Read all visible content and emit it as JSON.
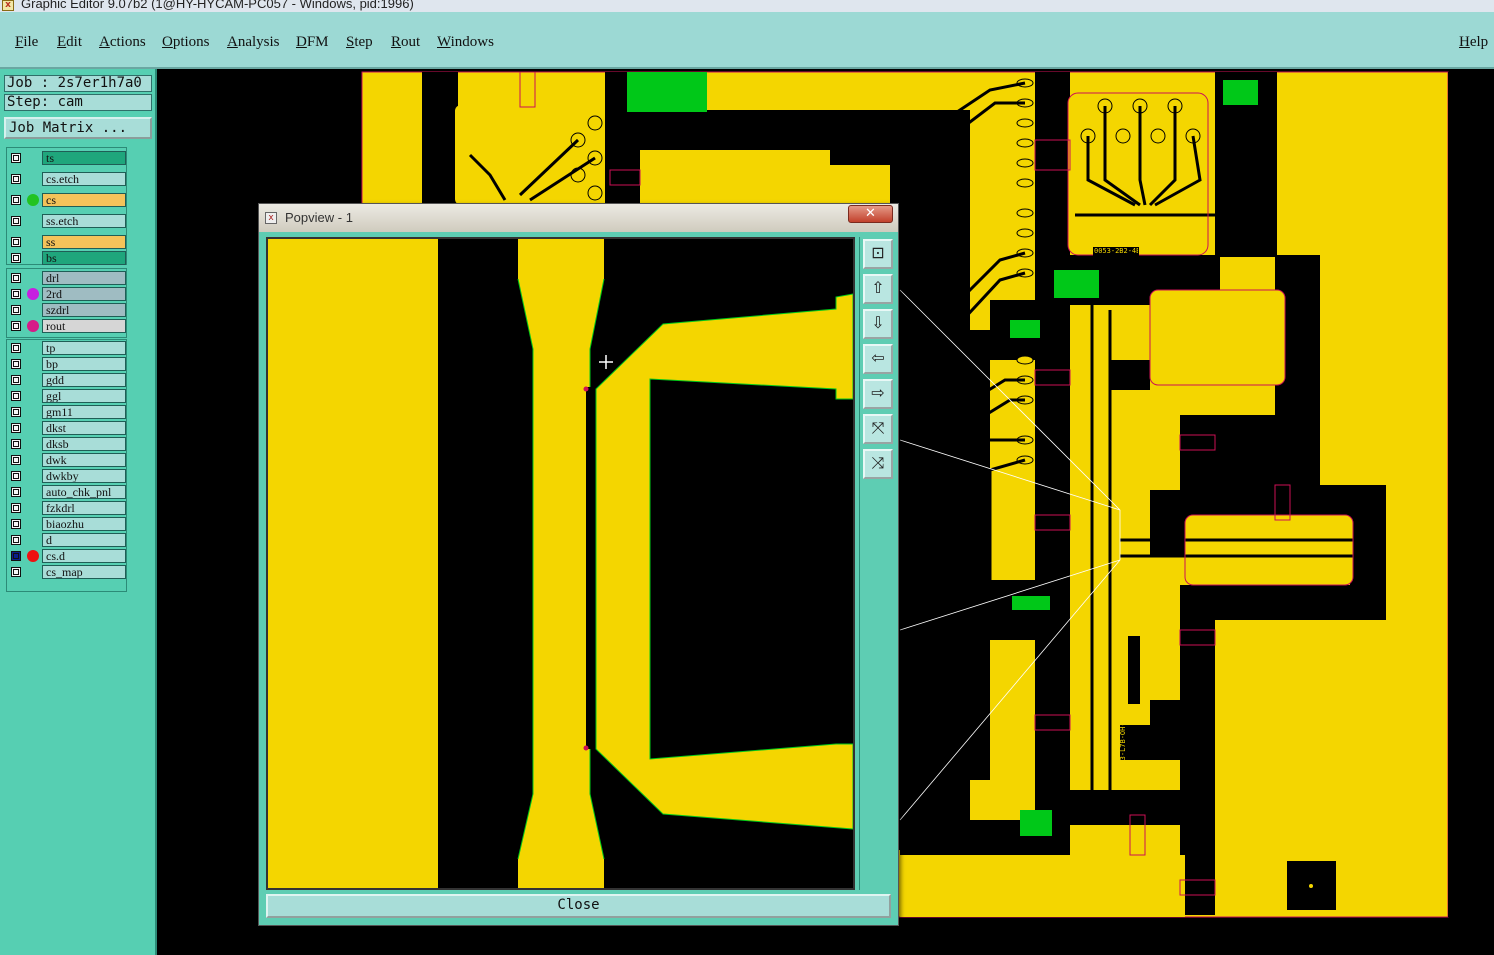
{
  "window": {
    "title": "Graphic Editor 9.07b2 (1@HY-HYCAM-PC057 - Windows, pid:1996)"
  },
  "menu": {
    "items": [
      "File",
      "Edit",
      "Actions",
      "Options",
      "Analysis",
      "DFM",
      "Step",
      "Rout",
      "Windows"
    ],
    "help": "Help"
  },
  "job": {
    "job_label": "Job : 2s7er1h7a0",
    "step_label": "Step: cam",
    "matrix_button": "Job Matrix ..."
  },
  "layers": {
    "group1": [
      {
        "name": "ts",
        "color": "#1fa67c",
        "dot": ""
      },
      {
        "name": "cs.etch",
        "color": "#a8ddd8",
        "dot": ""
      },
      {
        "name": "cs",
        "color": "#f4c35a",
        "dot": "#22c322"
      },
      {
        "name": "ss.etch",
        "color": "#a8ddd8",
        "dot": ""
      },
      {
        "name": "ss",
        "color": "#f4c35a",
        "dot": ""
      },
      {
        "name": "bs",
        "color": "#1fa67c",
        "dot": ""
      }
    ],
    "group2": [
      {
        "name": "drl",
        "color": "#9fbcc2",
        "dot": ""
      },
      {
        "name": "2rd",
        "color": "#9fbcc2",
        "dot": "#c61fe0"
      },
      {
        "name": "szdrl",
        "color": "#9fbcc2",
        "dot": ""
      },
      {
        "name": "rout",
        "color": "#d6d6d6",
        "dot": "#d61a88"
      }
    ],
    "group3": [
      {
        "name": "tp",
        "color": "#a8ddd8",
        "dot": ""
      },
      {
        "name": "bp",
        "color": "#a8ddd8",
        "dot": ""
      },
      {
        "name": "gdd",
        "color": "#a8ddd8",
        "dot": ""
      },
      {
        "name": "ggl",
        "color": "#a8ddd8",
        "dot": ""
      },
      {
        "name": "gm11",
        "color": "#a8ddd8",
        "dot": ""
      },
      {
        "name": "dkst",
        "color": "#a8ddd8",
        "dot": ""
      },
      {
        "name": "dksb",
        "color": "#a8ddd8",
        "dot": ""
      },
      {
        "name": "dwk",
        "color": "#a8ddd8",
        "dot": ""
      },
      {
        "name": "dwkby",
        "color": "#a8ddd8",
        "dot": ""
      },
      {
        "name": "auto_chk_pnl",
        "color": "#a8ddd8",
        "dot": ""
      },
      {
        "name": "fzkdrl",
        "color": "#a8ddd8",
        "dot": ""
      },
      {
        "name": "biaozhu",
        "color": "#a8ddd8",
        "dot": ""
      },
      {
        "name": "d",
        "color": "#a8ddd8",
        "dot": ""
      },
      {
        "name": "cs.d",
        "color": "#a8ddd8",
        "dot": "#ee1111",
        "active": true
      },
      {
        "name": "cs_map",
        "color": "#a8ddd8",
        "dot": ""
      }
    ]
  },
  "popview": {
    "title": "Popview - 1",
    "close_x": "✕",
    "close_button": "Close",
    "tools": [
      "zoom-window-icon",
      "pan-up-icon",
      "pan-down-icon",
      "pan-left-icon",
      "pan-right-icon",
      "zoom-in-icon",
      "zoom-out-icon"
    ]
  },
  "board_labels": {
    "label_a": "0053-2B2-4B",
    "label_b": "0053-L7B-OH-A0"
  },
  "colors": {
    "copper": "#f4d600",
    "pad_green": "#00c818",
    "outline": "#cc1155"
  }
}
